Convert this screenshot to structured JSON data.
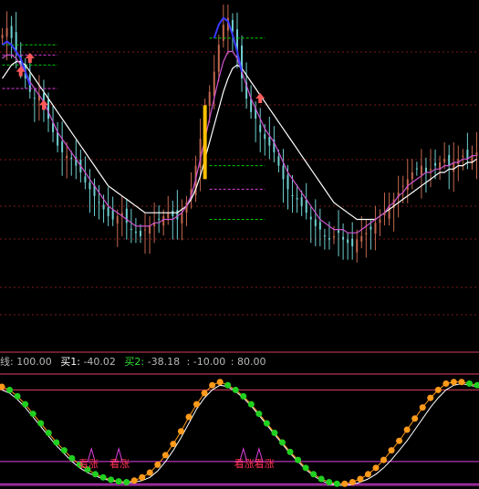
{
  "colors": {
    "background": "#000000",
    "grid": "#7a1a1a",
    "bull_candle": "#c2674e",
    "bear_candle": "#6ecfcf",
    "ma_white": "#ffffff",
    "ma_magenta": "#d055d0",
    "ma_blue": "#3a3aff",
    "hline_green": "#00d000",
    "hline_magenta": "#e040e0",
    "divider": "#d04060",
    "orange": "#ff9a1a",
    "green": "#20d020",
    "label_gray": "#b8b8b8",
    "label_red": "#ff4444",
    "label_green": "#33dd33",
    "signal_text": "#ff3355"
  },
  "indicator_header": {
    "line_label": "线:",
    "line_value": "100.00",
    "buy1_label": "买1:",
    "buy1_value": "-40.02",
    "buy2_label": "买2:",
    "buy2_value": "-38.18",
    "level3_value": ": -10.00",
    "level4_value": ": 80.00"
  },
  "signals": [
    {
      "label": "看涨",
      "x_index": 11
    },
    {
      "label": "看涨",
      "x_index": 15
    },
    {
      "label": "看涨看涨",
      "x_index": 31
    }
  ],
  "chart_data": [
    {
      "type": "candlestick",
      "title": "",
      "xlabel": "",
      "ylabel": "",
      "grid": true,
      "ylim": [
        0,
        100
      ],
      "bars": 104,
      "close": [
        91,
        93,
        90,
        86,
        82,
        78,
        74,
        72,
        73,
        70,
        66,
        62,
        58,
        56,
        55,
        54,
        52,
        50,
        47,
        45,
        43,
        41,
        39,
        37,
        36,
        37,
        38,
        35,
        33,
        32,
        31,
        33,
        34,
        35,
        36,
        37,
        38,
        37,
        36,
        38,
        41,
        45,
        52,
        60,
        68,
        74,
        80,
        88,
        94,
        96,
        92,
        86,
        78,
        72,
        68,
        66,
        62,
        60,
        58,
        56,
        52,
        48,
        45,
        43,
        42,
        40,
        38,
        36,
        34,
        33,
        31,
        30,
        31,
        32,
        30,
        29,
        28,
        30,
        31,
        32,
        33,
        35,
        36,
        38,
        40,
        42,
        44,
        46,
        48,
        50,
        51,
        52,
        50,
        51,
        52,
        53,
        54,
        52,
        53,
        54,
        55,
        54,
        55,
        56
      ],
      "moving_averages": [
        {
          "name": "",
          "color": "#ffffff",
          "values": [
            78,
            80,
            82,
            83,
            83,
            82,
            80,
            78,
            76,
            74,
            72,
            70,
            68,
            66,
            64,
            62,
            60,
            58,
            56,
            54,
            52,
            50,
            48,
            46,
            45,
            44,
            43,
            42,
            41,
            40,
            39,
            38,
            38,
            38,
            38,
            38,
            38,
            38,
            38,
            39,
            40,
            42,
            45,
            49,
            54,
            59,
            64,
            69,
            74,
            78,
            81,
            82,
            81,
            79,
            77,
            75,
            73,
            71,
            69,
            67,
            65,
            63,
            61,
            59,
            57,
            55,
            53,
            51,
            49,
            47,
            45,
            43,
            41,
            40,
            39,
            38,
            37,
            36,
            36,
            36,
            36,
            36,
            37,
            38,
            39,
            40,
            41,
            42,
            43,
            44,
            45,
            46,
            47,
            48,
            49,
            50,
            50,
            51,
            51,
            52,
            52,
            53,
            53,
            54
          ]
        },
        {
          "name": "",
          "color": "#d055d0",
          "values": [
            84,
            85,
            85,
            84,
            82,
            80,
            77,
            75,
            73,
            71,
            68,
            65,
            62,
            60,
            58,
            56,
            54,
            52,
            50,
            48,
            46,
            44,
            42,
            40,
            39,
            38,
            37,
            36,
            35,
            34,
            34,
            34,
            34,
            35,
            35,
            36,
            36,
            36,
            37,
            38,
            40,
            43,
            48,
            54,
            60,
            66,
            72,
            78,
            83,
            86,
            86,
            84,
            80,
            76,
            72,
            69,
            66,
            63,
            61,
            59,
            56,
            53,
            50,
            48,
            46,
            44,
            42,
            40,
            38,
            36,
            35,
            34,
            33,
            33,
            33,
            32,
            32,
            32,
            33,
            34,
            35,
            36,
            37,
            38,
            40,
            41,
            43,
            44,
            46,
            47,
            48,
            49,
            50,
            50,
            51,
            51,
            52,
            52,
            53,
            53,
            54,
            54,
            55,
            55
          ]
        },
        {
          "name": "",
          "color": "#3a3aff",
          "values": [
            88,
            89,
            88,
            86,
            84,
            80,
            76,
            null,
            null,
            null,
            null,
            null,
            null,
            null,
            null,
            null,
            null,
            null,
            null,
            null,
            null,
            null,
            null,
            null,
            null,
            null,
            null,
            null,
            null,
            null,
            null,
            null,
            null,
            null,
            null,
            null,
            null,
            null,
            null,
            null,
            null,
            null,
            null,
            null,
            null,
            null,
            90,
            94,
            96,
            95,
            91,
            86,
            80,
            null,
            null,
            null,
            null,
            null,
            null,
            null,
            null,
            null,
            null,
            null,
            null,
            null,
            null,
            null,
            null,
            null,
            null,
            null,
            null,
            null,
            null,
            null,
            null,
            null,
            null,
            null,
            null,
            null,
            null,
            null,
            null,
            null,
            null,
            null,
            null,
            null,
            null,
            null,
            null,
            null,
            null,
            null,
            null,
            null,
            null,
            null,
            null,
            null,
            null,
            null
          ]
        }
      ],
      "reference_levels": [
        {
          "label": "",
          "color": "#00d000",
          "x_range": [
            0,
            12
          ],
          "values": [
            88,
            82
          ]
        },
        {
          "label": "",
          "color": "#e040e0",
          "x_range": [
            0,
            12
          ],
          "values": [
            85,
            75
          ]
        },
        {
          "label": "",
          "color": "#00d000",
          "x_range": [
            45,
            57
          ],
          "values": [
            90,
            52
          ]
        },
        {
          "label": "",
          "color": "#e040e0",
          "x_range": [
            45,
            57
          ],
          "values": [
            45
          ]
        },
        {
          "label": "",
          "color": "#00d000",
          "x_range": [
            45,
            57
          ],
          "values": [
            36
          ]
        }
      ]
    },
    {
      "type": "line",
      "title": "",
      "xlabel": "",
      "ylabel": "",
      "ylim": [
        -40,
        100
      ],
      "levels": [
        100.0,
        -40.02,
        -38.18,
        -10.0,
        80.0
      ],
      "series": [
        {
          "name": "",
          "color": "#ffffff",
          "values": [
            80,
            76,
            68,
            58,
            46,
            34,
            22,
            10,
            0,
            -10,
            -18,
            -24,
            -28,
            -32,
            -34,
            -36,
            -37,
            -36,
            -34,
            -30,
            -22,
            -10,
            4,
            20,
            38,
            56,
            70,
            80,
            86,
            84,
            78,
            70,
            60,
            48,
            36,
            24,
            12,
            0,
            -10,
            -20,
            -28,
            -34,
            -38,
            -40,
            -40,
            -39,
            -36,
            -32,
            -26,
            -18,
            -8,
            4,
            16,
            30,
            44,
            58,
            70,
            80,
            86,
            88,
            86,
            84
          ]
        },
        {
          "name": "",
          "color": "#ff9a1a",
          "values": [
            84,
            80,
            72,
            62,
            50,
            38,
            26,
            14,
            4,
            -6,
            -14,
            -20,
            -26,
            -30,
            -33,
            -35,
            -36,
            -34,
            -30,
            -24,
            -14,
            -2,
            12,
            28,
            46,
            62,
            76,
            86,
            90,
            86,
            80,
            72,
            62,
            50,
            38,
            26,
            14,
            2,
            -8,
            -18,
            -26,
            -32,
            -36,
            -38,
            -38,
            -36,
            -32,
            -26,
            -18,
            -8,
            4,
            16,
            30,
            44,
            58,
            70,
            80,
            88,
            90,
            90,
            88,
            86
          ]
        }
      ]
    }
  ]
}
